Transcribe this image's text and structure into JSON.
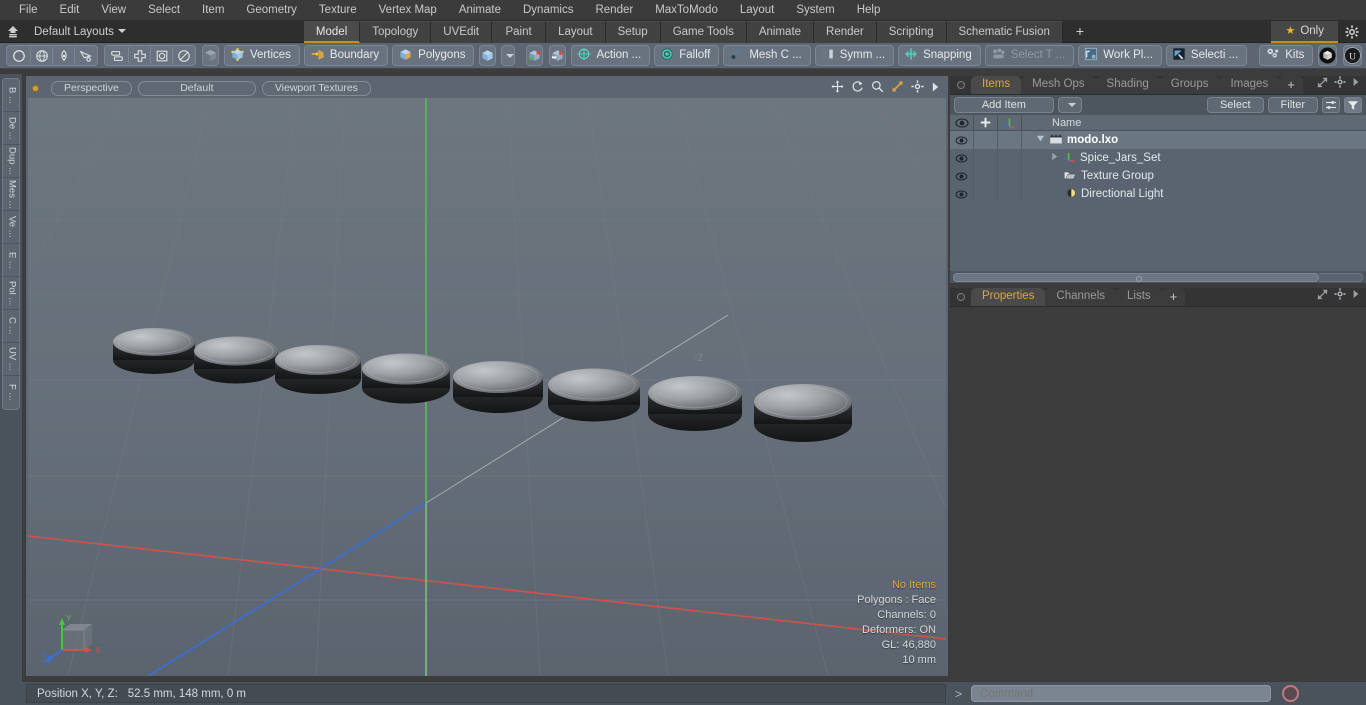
{
  "menubar": {
    "items": [
      "File",
      "Edit",
      "View",
      "Select",
      "Item",
      "Geometry",
      "Texture",
      "Vertex Map",
      "Animate",
      "Dynamics",
      "Render",
      "MaxToModo",
      "Layout",
      "System",
      "Help"
    ]
  },
  "layoutbar": {
    "home_icon": "home-icon",
    "layouts_label": "Default Layouts",
    "tabs": [
      {
        "label": "Model",
        "active": true
      },
      {
        "label": "Topology",
        "active": false
      },
      {
        "label": "UVEdit",
        "active": false
      },
      {
        "label": "Paint",
        "active": false
      },
      {
        "label": "Layout",
        "active": false
      },
      {
        "label": "Setup",
        "active": false
      },
      {
        "label": "Game Tools",
        "active": false
      },
      {
        "label": "Animate",
        "active": false
      },
      {
        "label": "Render",
        "active": false
      },
      {
        "label": "Scripting",
        "active": false
      },
      {
        "label": "Schematic Fusion",
        "active": false
      }
    ],
    "add_tab_label": "+",
    "only_label": "Only",
    "star_icon": "star-icon",
    "gear_icon": "gear-icon"
  },
  "toolbar": {
    "group1": [
      "circle-icon",
      "globe-icon",
      "pen-icon",
      "curve-icon"
    ],
    "group2": [
      "mirror-icon",
      "symmetry-icon",
      "center-icon",
      "ellipse-icon"
    ],
    "solo": "cube-shaded-icon",
    "chips": [
      {
        "label": "Vertices",
        "icon": "vertices-cube-icon",
        "dim": false
      },
      {
        "label": "Boundary",
        "icon": "boundary-cube-icon",
        "dim": false
      },
      {
        "label": "Polygons",
        "icon": "polygons-cube-icon",
        "dim": false
      }
    ],
    "mode_icon": "cube-orange-icon",
    "mode_dropdown": "chevron-down-icon",
    "snap_icons": [
      "snap-vertex-icon",
      "snap-edge-icon"
    ],
    "chips2": [
      {
        "label": "Action  ...",
        "icon": "action-center-icon",
        "dim": false
      },
      {
        "label": "Falloff",
        "icon": "falloff-icon",
        "dim": false
      },
      {
        "label": "Mesh C ...",
        "icon": "mesh-constraint-icon",
        "dim": false
      },
      {
        "label": "Symm ...",
        "icon": "symmetry-bars-icon",
        "dim": false
      },
      {
        "label": "Snapping",
        "icon": "snapping-icon",
        "dim": false
      },
      {
        "label": "Select T ...",
        "icon": "select-through-icon",
        "dim": true
      },
      {
        "label": "Work Pl...",
        "icon": "work-plane-icon",
        "dim": false
      },
      {
        "label": "Selecti  ...",
        "icon": "selection-set-icon",
        "dim": false
      },
      {
        "label": "Kits",
        "icon": "kits-gears-icon",
        "dim": false
      }
    ],
    "right_icons": [
      "modo-ball-icon",
      "unreal-icon"
    ]
  },
  "left_strip": {
    "tabs": [
      "B ...",
      "De ...",
      "Dup ...",
      "Mes ...",
      "Ve ...",
      "E ...",
      "Pol ...",
      "C ...",
      "UV ...",
      "F ..."
    ]
  },
  "viewport": {
    "dot": "active-viewport-dot",
    "pills": [
      "Perspective",
      "Default",
      "Viewport Textures"
    ],
    "icons": [
      "move-icon",
      "rotate-icon",
      "zoom-icon",
      "fit-icon",
      "gear-icon",
      "chevron-right-icon"
    ],
    "axis_label": "-Z",
    "gizmo": {
      "x": "X",
      "y": "Y",
      "z": "Z"
    },
    "info": [
      "No Items",
      "Polygons : Face",
      "Channels: 0",
      "Deformers: ON",
      "GL: 46,880",
      "10 mm"
    ]
  },
  "right_panel": {
    "top_tabs": [
      {
        "label": "Items",
        "active": true
      },
      {
        "label": "Mesh Ops",
        "active": false
      },
      {
        "label": "Shading",
        "active": false
      },
      {
        "label": "Groups",
        "active": false
      },
      {
        "label": "Images",
        "active": false
      },
      {
        "label": "+",
        "active": false
      }
    ],
    "top_tab_icons": [
      "expand-icon",
      "gear-icon",
      "chevron-right-icon"
    ],
    "add_item_label": "Add Item",
    "add_item_dropdown": "chevron-down-icon",
    "select_label": "Select",
    "filter_label": "Filter",
    "list_options_icon": "list-options-icon",
    "funnel_icon": "funnel-icon",
    "tree_headers": {
      "eye": "eye-icon",
      "lock": "lock-icon",
      "axis": "axis-icon",
      "name": "Name"
    },
    "tree_rows": [
      {
        "label": "modo.lxo",
        "icon": "scene-clapper-icon",
        "indent": 0,
        "bold": true,
        "twisty": "down",
        "selected": true
      },
      {
        "label": "Spice_Jars_Set",
        "icon": "mesh-axis-icon",
        "indent": 1,
        "bold": false,
        "twisty": "right",
        "selected": false
      },
      {
        "label": "Texture Group",
        "icon": "texture-group-icon",
        "indent": 1,
        "bold": false,
        "twisty": "none",
        "selected": false
      },
      {
        "label": "Directional Light",
        "icon": "directional-light-icon",
        "indent": 1,
        "bold": false,
        "twisty": "none",
        "selected": false
      }
    ],
    "bottom_tabs": [
      {
        "label": "Properties",
        "active": true
      },
      {
        "label": "Channels",
        "active": false
      },
      {
        "label": "Lists",
        "active": false
      },
      {
        "label": "+",
        "active": false
      }
    ],
    "bottom_tab_icons": [
      "expand-icon",
      "gear-icon",
      "chevron-right-icon"
    ]
  },
  "statusbar": {
    "position_label": "Position X, Y, Z:",
    "position_value": "52.5 mm,  148 mm,  0 m",
    "command_prompt": ">",
    "command_placeholder": "Command",
    "record_icon": "record-icon"
  },
  "colors": {
    "accent_orange": "#e0a53e",
    "toolbar_blue": "#5c6570",
    "panel_dark": "#3c3c3c",
    "axis_x": "#d4524a",
    "axis_y": "#49c24a",
    "axis_z": "#3a6fd8"
  }
}
